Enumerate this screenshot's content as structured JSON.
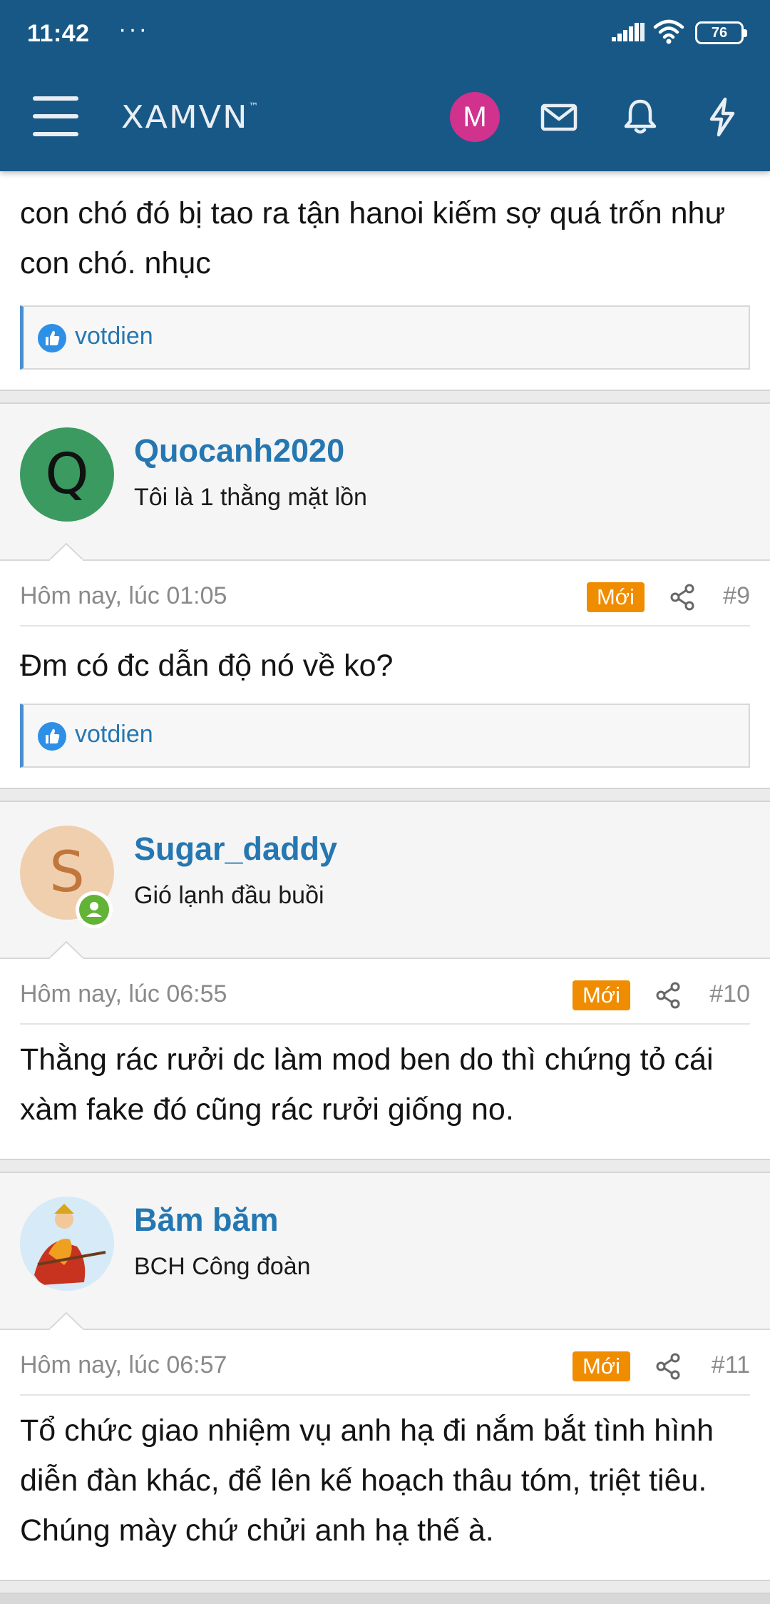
{
  "status_bar": {
    "time": "11:42",
    "dots": "···",
    "battery": "76"
  },
  "header": {
    "logo": "XAMVN",
    "logo_tm": "™",
    "avatar_letter": "M"
  },
  "posts": {
    "prev": {
      "message": "con chó đó bị tao ra tận hanoi kiếm sợ quá trốn như con chó. nhục",
      "reaction_user": "votdien"
    },
    "p9": {
      "avatar_letter": "Q",
      "avatar_color": "#3a9a60",
      "username": "Quocanh2020",
      "user_title": "Tôi là 1 thằng mặt lồn",
      "date": "Hôm nay, lúc 01:05",
      "badge": "Mới",
      "number": "#9",
      "message": "Đm có đc dẫn độ nó về ko?",
      "reaction_user": "votdien"
    },
    "p10": {
      "avatar_letter": "S",
      "avatar_color": "#f0cfae",
      "username": "Sugar_daddy",
      "user_title": "Gió lạnh đầu buồi",
      "date": "Hôm nay, lúc 06:55",
      "badge": "Mới",
      "number": "#10",
      "message": "Thằng rác rưởi dc làm mod ben do thì chứng tỏ cái xàm fake đó cũng rác rưởi giống no."
    },
    "p11": {
      "username": "Băm băm",
      "user_title": "BCH Công đoàn",
      "date": "Hôm nay, lúc 06:57",
      "badge": "Mới",
      "number": "#11",
      "message": "Tổ chức giao nhiệm vụ anh hạ đi nắm bắt tình hình diễn đàn khác, để lên kế hoạch thâu tóm, triệt tiêu. Chúng mày chứ chửi anh hạ thế à."
    }
  },
  "colors": {
    "header_bg": "#185886",
    "link": "#2577b1",
    "badge": "#f08c00",
    "online": "#63b336"
  }
}
